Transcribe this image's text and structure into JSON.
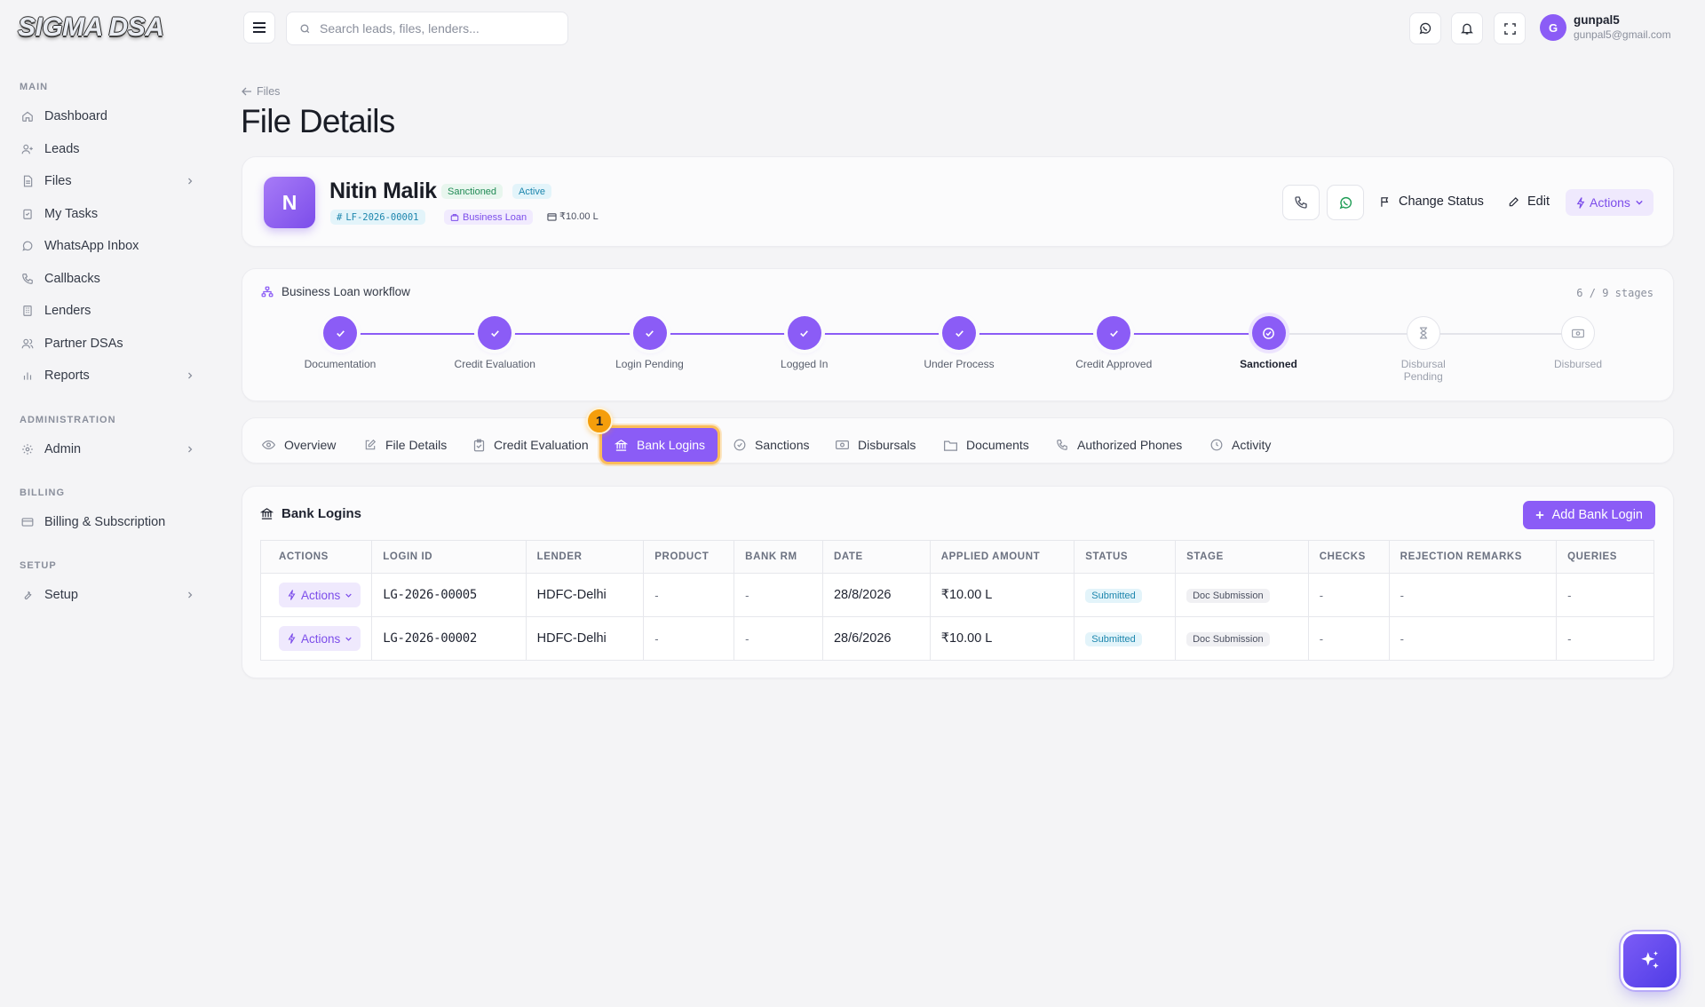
{
  "brand": {
    "logo_text": "SIGMA DSA",
    "accent": "#8b5cf6"
  },
  "sidebar": {
    "sections": {
      "main": "MAIN",
      "administration": "ADMINISTRATION",
      "billing": "BILLING",
      "setup": "SETUP"
    },
    "items": [
      {
        "label": "Dashboard",
        "icon": "home-icon"
      },
      {
        "label": "Leads",
        "icon": "user-plus-icon"
      },
      {
        "label": "Files",
        "icon": "file-icon",
        "has_children": true
      },
      {
        "label": "My Tasks",
        "icon": "clipboard-check-icon"
      },
      {
        "label": "WhatsApp Inbox",
        "icon": "whatsapp-icon"
      },
      {
        "label": "Callbacks",
        "icon": "phone-icon"
      },
      {
        "label": "Lenders",
        "icon": "building-icon"
      },
      {
        "label": "Partner DSAs",
        "icon": "users-icon"
      },
      {
        "label": "Reports",
        "icon": "bar-chart-icon",
        "has_children": true
      },
      {
        "label": "Admin",
        "icon": "gear-icon",
        "has_children": true
      },
      {
        "label": "Billing & Subscription",
        "icon": "credit-card-icon"
      },
      {
        "label": "Setup",
        "icon": "wrench-icon",
        "has_children": true
      }
    ]
  },
  "topbar": {
    "search_placeholder": "Search leads, files, lenders...",
    "user": {
      "initial": "G",
      "name": "gunpal5",
      "email": "gunpal5@gmail.com"
    }
  },
  "page": {
    "back_label": "Files",
    "title": "File Details"
  },
  "profile": {
    "initial": "N",
    "name": "Nitin Malik",
    "status_badge": "Sanctioned",
    "state_badge": "Active",
    "file_id": "LF-2026-00001",
    "product": "Business Loan",
    "amount": "₹10.00 L",
    "actions": {
      "change_status": "Change Status",
      "edit": "Edit",
      "actions": "Actions"
    }
  },
  "workflow": {
    "title": "Business Loan workflow",
    "progress": "6 / 9 stages",
    "stages": [
      {
        "label": "Documentation",
        "state": "done"
      },
      {
        "label": "Credit Evaluation",
        "state": "done"
      },
      {
        "label": "Login Pending",
        "state": "done"
      },
      {
        "label": "Logged In",
        "state": "done"
      },
      {
        "label": "Under Process",
        "state": "done"
      },
      {
        "label": "Credit Approved",
        "state": "done"
      },
      {
        "label": "Sanctioned",
        "state": "current"
      },
      {
        "label": "Disbursal Pending",
        "state": "todo"
      },
      {
        "label": "Disbursed",
        "state": "todo"
      }
    ]
  },
  "tabs": {
    "items": [
      {
        "label": "Overview",
        "icon": "eye-icon"
      },
      {
        "label": "File Details",
        "icon": "edit-icon"
      },
      {
        "label": "Credit Evaluation",
        "icon": "clipboard-icon"
      },
      {
        "label": "Bank Logins",
        "icon": "bank-icon",
        "active": true
      },
      {
        "label": "Sanctions",
        "icon": "check-circle-icon"
      },
      {
        "label": "Disbursals",
        "icon": "banknote-icon"
      },
      {
        "label": "Documents",
        "icon": "folder-icon"
      },
      {
        "label": "Authorized Phones",
        "icon": "phone-icon"
      },
      {
        "label": "Activity",
        "icon": "clock-icon"
      }
    ],
    "step_marker": "1"
  },
  "bank_logins": {
    "title": "Bank Logins",
    "add_label": "Add Bank Login",
    "columns": [
      "ACTIONS",
      "LOGIN ID",
      "LENDER",
      "PRODUCT",
      "BANK RM",
      "DATE",
      "APPLIED AMOUNT",
      "STATUS",
      "STAGE",
      "CHECKS",
      "REJECTION REMARKS",
      "QUERIES"
    ],
    "rows": [
      {
        "actions": "Actions",
        "login_id": "LG-2026-00005",
        "lender": "HDFC-Delhi",
        "product": "-",
        "bank_rm": "-",
        "date": "28/8/2026",
        "amount": "₹10.00 L",
        "status": "Submitted",
        "stage": "Doc Submission",
        "checks": "-",
        "rejection": "-",
        "queries": "-"
      },
      {
        "actions": "Actions",
        "login_id": "LG-2026-00002",
        "lender": "HDFC-Delhi",
        "product": "-",
        "bank_rm": "-",
        "date": "28/6/2026",
        "amount": "₹10.00 L",
        "status": "Submitted",
        "stage": "Doc Submission",
        "checks": "-",
        "rejection": "-",
        "queries": "-"
      }
    ]
  }
}
